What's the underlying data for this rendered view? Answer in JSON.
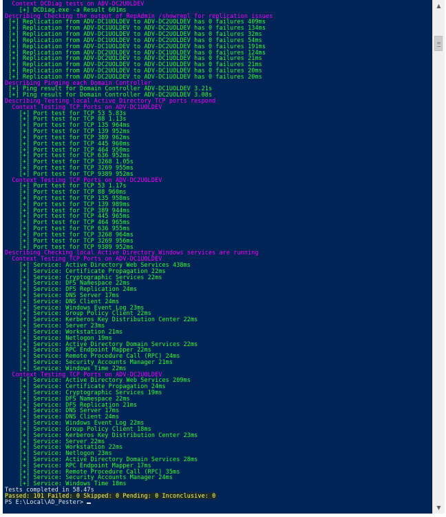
{
  "console": {
    "lines": [
      {
        "text": "  Context DCDiag tests on ADV-DC2UOLDEV",
        "color": "magenta"
      },
      {
        "text": "    [+] DCDiag.exe -a Result 601ms",
        "color": "green"
      },
      {
        "text": "Describing Checking the output of RepAdmin /showrepl for replication issues",
        "color": "magenta"
      },
      {
        "text": " [+] Replication from ADV-DC1UOLDEV to ADV-DC2UOLDEV has 0 failures 409ms",
        "color": "green"
      },
      {
        "text": " [+] Replication from ADV-DC1UOLDEV to ADV-DC2UOLDEV has 0 failures 134ms",
        "color": "green"
      },
      {
        "text": " [+] Replication from ADV-DC1UOLDEV to ADV-DC2UOLDEV has 0 failures 32ms",
        "color": "green"
      },
      {
        "text": " [+] Replication from ADV-DC1UOLDEV to ADV-DC2UOLDEV has 0 failures 54ms",
        "color": "green"
      },
      {
        "text": " [+] Replication from ADV-DC1UOLDEV to ADV-DC2UOLDEV has 0 failures 191ms",
        "color": "green"
      },
      {
        "text": " [+] Replication from ADV-DC2UOLDEV to ADV-DC1UOLDEV has 0 failures 124ms",
        "color": "green"
      },
      {
        "text": " [+] Replication from ADV-DC2UOLDEV to ADV-DC1UOLDEV has 0 failures 21ms",
        "color": "green"
      },
      {
        "text": " [+] Replication from ADV-DC2UOLDEV to ADV-DC1UOLDEV has 0 failures 21ms",
        "color": "green"
      },
      {
        "text": " [+] Replication from ADV-DC2UOLDEV to ADV-DC1UOLDEV has 0 failures 20ms",
        "color": "green"
      },
      {
        "text": " [+] Replication from ADV-DC2UOLDEV to ADV-DC1UOLDEV has 0 failures 20ms",
        "color": "green"
      },
      {
        "text": "Describing Pinging each Domain Controller",
        "color": "magenta"
      },
      {
        "text": " [+] Ping result for Domain Controller ADV-DC1UOLDEV 3.21s",
        "color": "green"
      },
      {
        "text": " [+] Ping result for Domain Controller ADV-DC2UOLDEV 3.08s",
        "color": "green"
      },
      {
        "text": "Describing Testing local Active Directory TCP ports respond",
        "color": "magenta"
      },
      {
        "text": "  Context Testing TCP Ports on ADV-DC1UOLDEV",
        "color": "magenta"
      },
      {
        "text": "    [+] Port test for TCP 53 5.83s",
        "color": "green"
      },
      {
        "text": "    [+] Port test for TCP 88 1.13s",
        "color": "green"
      },
      {
        "text": "    [+] Port test for TCP 135 964ms",
        "color": "green"
      },
      {
        "text": "    [+] Port test for TCP 139 952ms",
        "color": "green"
      },
      {
        "text": "    [+] Port test for TCP 389 962ms",
        "color": "green"
      },
      {
        "text": "    [+] Port test for TCP 445 960ms",
        "color": "green"
      },
      {
        "text": "    [+] Port test for TCP 464 950ms",
        "color": "green"
      },
      {
        "text": "    [+] Port test for TCP 636 952ms",
        "color": "green"
      },
      {
        "text": "    [+] Port test for TCP 3268 1.05s",
        "color": "green"
      },
      {
        "text": "    [+] Port test for TCP 3269 955ms",
        "color": "green"
      },
      {
        "text": "    [+] Port test for TCP 9389 952ms",
        "color": "green"
      },
      {
        "text": "  Context Testing TCP Ports on ADV-DC2UOLDEV",
        "color": "magenta"
      },
      {
        "text": "    [+] Port test for TCP 53 1.17s",
        "color": "green"
      },
      {
        "text": "    [+] Port test for TCP 88 960ms",
        "color": "green"
      },
      {
        "text": "    [+] Port test for TCP 135 958ms",
        "color": "green"
      },
      {
        "text": "    [+] Port test for TCP 139 989ms",
        "color": "green"
      },
      {
        "text": "    [+] Port test for TCP 389 944ms",
        "color": "green"
      },
      {
        "text": "    [+] Port test for TCP 445 965ms",
        "color": "green"
      },
      {
        "text": "    [+] Port test for TCP 464 965ms",
        "color": "green"
      },
      {
        "text": "    [+] Port test for TCP 636 955ms",
        "color": "green"
      },
      {
        "text": "    [+] Port test for TCP 3268 964ms",
        "color": "green"
      },
      {
        "text": "    [+] Port test for TCP 3269 956ms",
        "color": "green"
      },
      {
        "text": "    [+] Port test for TCP 9389 952ms",
        "color": "green"
      },
      {
        "text": "Describing Checking local Active Directory Windows services are running",
        "color": "magenta"
      },
      {
        "text": "  Context Testing TCP Ports on ADV-DC1UOLDEV",
        "color": "magenta"
      },
      {
        "text": "    [+] Service: Active Directory Web Services 438ms",
        "color": "green"
      },
      {
        "text": "    [+] Service: Certificate Propagation 22ms",
        "color": "green"
      },
      {
        "text": "    [+] Service: Cryptographic Services 22ms",
        "color": "green"
      },
      {
        "text": "    [+] Service: DFS Namespace 22ms",
        "color": "green"
      },
      {
        "text": "    [+] Service: DFS Replication 24ms",
        "color": "green"
      },
      {
        "text": "    [+] Service: DNS Server 17ms",
        "color": "green"
      },
      {
        "text": "    [+] Service: DNS Client 24ms",
        "color": "green"
      },
      {
        "text": "    [+] Service: Windows Event Log 23ms",
        "color": "green"
      },
      {
        "text": "    [+] Service: Group Policy Client 22ms",
        "color": "green"
      },
      {
        "text": "    [+] Service: Kerberos Key Distribution Center 22ms",
        "color": "green"
      },
      {
        "text": "    [+] Service: Server 23ms",
        "color": "green"
      },
      {
        "text": "    [+] Service: Workstation 21ms",
        "color": "green"
      },
      {
        "text": "    [+] Service: Netlogon 19ms",
        "color": "green"
      },
      {
        "text": "    [+] Service: Active Directory Domain Services 22ms",
        "color": "green"
      },
      {
        "text": "    [+] Service: RPC Endpoint Mapper 22ms",
        "color": "green"
      },
      {
        "text": "    [+] Service: Remote Procedure Call (RPC) 24ms",
        "color": "green"
      },
      {
        "text": "    [+] Service: Security Accounts Manager 21ms",
        "color": "green"
      },
      {
        "text": "    [+] Service: Windows Time 22ms",
        "color": "green"
      },
      {
        "text": "  Context Testing TCP Ports on ADV-DC2UOLDEV",
        "color": "magenta"
      },
      {
        "text": "    [+] Service: Active Directory Web Services 209ms",
        "color": "green"
      },
      {
        "text": "    [+] Service: Certificate Propagation 24ms",
        "color": "green"
      },
      {
        "text": "    [+] Service: Cryptographic Services 19ms",
        "color": "green"
      },
      {
        "text": "    [+] Service: DFS Namespace 22ms",
        "color": "green"
      },
      {
        "text": "    [+] Service: DFS Replication 21ms",
        "color": "green"
      },
      {
        "text": "    [+] Service: DNS Server 17ms",
        "color": "green"
      },
      {
        "text": "    [+] Service: DNS Client 24ms",
        "color": "green"
      },
      {
        "text": "    [+] Service: Windows Event Log 22ms",
        "color": "green"
      },
      {
        "text": "    [+] Service: Group Policy Client 18ms",
        "color": "green"
      },
      {
        "text": "    [+] Service: Kerberos Key Distribution Center 23ms",
        "color": "green"
      },
      {
        "text": "    [+] Service: Server 22ms",
        "color": "green"
      },
      {
        "text": "    [+] Service: Workstation 22ms",
        "color": "green"
      },
      {
        "text": "    [+] Service: Netlogon 23ms",
        "color": "green"
      },
      {
        "text": "    [+] Service: Active Directory Domain Services 28ms",
        "color": "green"
      },
      {
        "text": "    [+] Service: RPC Endpoint Mapper 17ms",
        "color": "green"
      },
      {
        "text": "    [+] Service: Remote Procedure Call (RPC) 35ms",
        "color": "green"
      },
      {
        "text": "    [+] Service: Security Accounts Manager 24ms",
        "color": "green"
      },
      {
        "text": "    [+] Service: Windows Time 18ms",
        "color": "green"
      }
    ],
    "summary": {
      "completed": "Tests completed in 58.47s",
      "passed": "Passed: 101 Failed: 0 Skipped: 0 Pending: 0 Inconclusive: 0"
    },
    "prompt": "PS E:\\Local\\AD_Pester> "
  },
  "scrollbar": {
    "up_icon": "up-arrow-icon",
    "down_icon": "down-arrow-icon",
    "up_glyph": "▲",
    "down_glyph": "▼"
  },
  "colors": {
    "background": "#012456",
    "magenta": "#ff00ff",
    "green": "#32ff32",
    "text": "#e8e8e8"
  }
}
